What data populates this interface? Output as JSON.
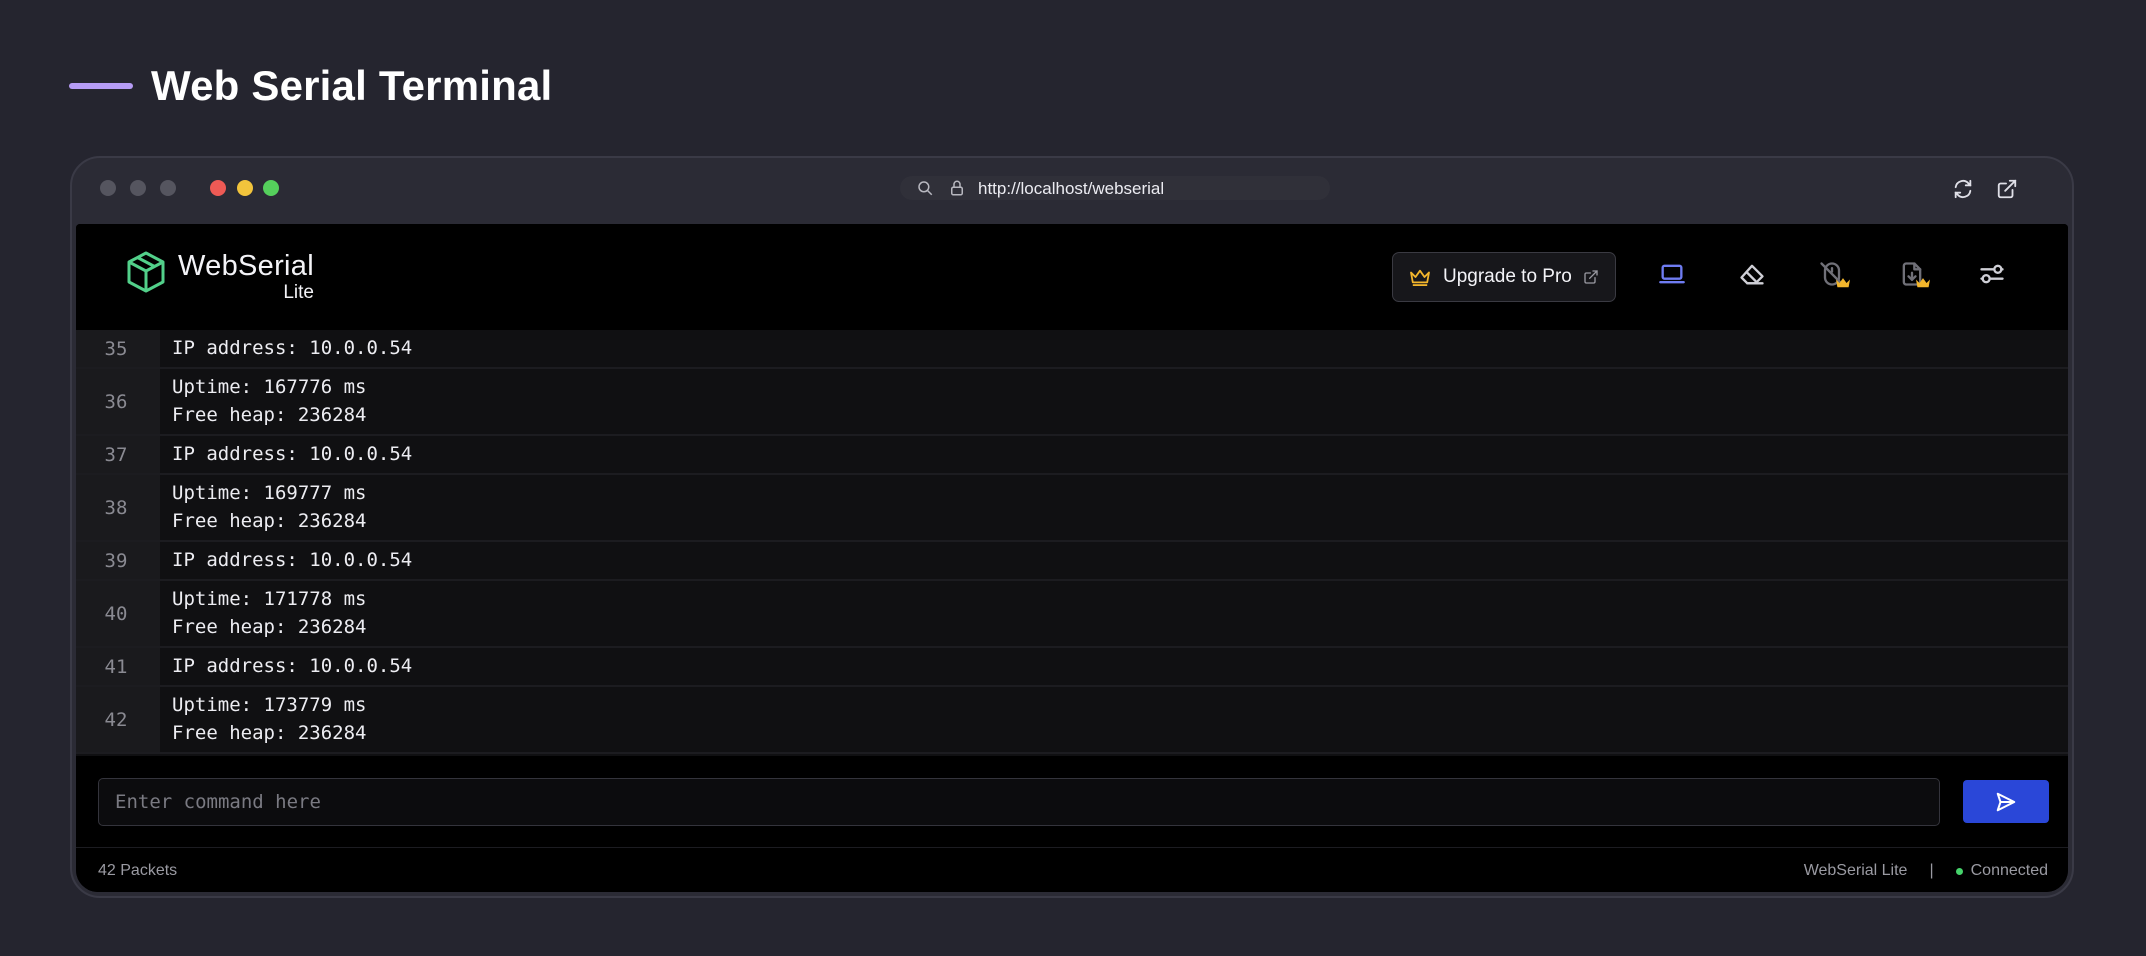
{
  "page_title": "Web Serial Terminal",
  "colors": {
    "accent": "#b69cf5",
    "send_button": "#2a47d8",
    "connected": "#46d36b",
    "crown": "#f2b52c",
    "logo": "#52d08a"
  },
  "browser": {
    "url": "http://localhost/webserial"
  },
  "app": {
    "logo_name": "WebSerial",
    "logo_sub": "Lite",
    "upgrade_label": "Upgrade to Pro",
    "toolbar_icons": [
      "monitor-icon",
      "eraser-icon",
      "mouse-off-icon",
      "file-download-icon",
      "sliders-icon"
    ]
  },
  "log": [
    {
      "line": "35",
      "text": [
        "IP address: 10.0.0.54"
      ]
    },
    {
      "line": "36",
      "text": [
        "Uptime: 167776 ms",
        "Free heap: 236284"
      ]
    },
    {
      "line": "37",
      "text": [
        "IP address: 10.0.0.54"
      ]
    },
    {
      "line": "38",
      "text": [
        "Uptime: 169777 ms",
        "Free heap: 236284"
      ]
    },
    {
      "line": "39",
      "text": [
        "IP address: 10.0.0.54"
      ]
    },
    {
      "line": "40",
      "text": [
        "Uptime: 171778 ms",
        "Free heap: 236284"
      ]
    },
    {
      "line": "41",
      "text": [
        "IP address: 10.0.0.54"
      ]
    },
    {
      "line": "42",
      "text": [
        "Uptime: 173779 ms",
        "Free heap: 236284"
      ]
    }
  ],
  "command": {
    "placeholder": "Enter command here",
    "value": ""
  },
  "status": {
    "packets": "42 Packets",
    "app_name": "WebSerial Lite",
    "separator": "|",
    "connection": "Connected"
  }
}
